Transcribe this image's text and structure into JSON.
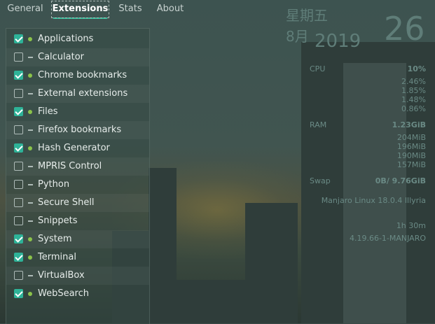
{
  "tabs": [
    {
      "label": "General",
      "active": false
    },
    {
      "label": "Extensions",
      "active": true
    },
    {
      "label": "Stats",
      "active": false
    },
    {
      "label": "About",
      "active": false
    }
  ],
  "extensions": [
    {
      "label": "Applications",
      "enabled": true
    },
    {
      "label": "Calculator",
      "enabled": false
    },
    {
      "label": "Chrome bookmarks",
      "enabled": true
    },
    {
      "label": "External extensions",
      "enabled": false
    },
    {
      "label": "Files",
      "enabled": true
    },
    {
      "label": "Firefox bookmarks",
      "enabled": false
    },
    {
      "label": "Hash Generator",
      "enabled": true
    },
    {
      "label": "MPRIS Control",
      "enabled": false
    },
    {
      "label": "Python",
      "enabled": false
    },
    {
      "label": "Secure Shell",
      "enabled": false
    },
    {
      "label": "Snippets",
      "enabled": false
    },
    {
      "label": "System",
      "enabled": true
    },
    {
      "label": "Terminal",
      "enabled": true
    },
    {
      "label": "VirtualBox",
      "enabled": false
    },
    {
      "label": "WebSearch",
      "enabled": true
    }
  ],
  "desktop_widget": {
    "day_of_week": "星期五",
    "month": "8月",
    "year": "2019",
    "date": "26",
    "cpu": {
      "label": "CPU",
      "value": "10%",
      "cores": [
        "2.46%",
        "1.85%",
        "1.48%",
        "0.86%"
      ]
    },
    "ram": {
      "label": "RAM",
      "value": "1.23GiB",
      "details": [
        "204MiB",
        "196MiB",
        "190MiB",
        "157MiB"
      ]
    },
    "swap": {
      "label": "Swap",
      "value": "0B/ 9.76GiB"
    },
    "os": "Manjaro Linux 18.0.4 Illyria",
    "uptime": "1h 30m",
    "kernel": "4.19.66-1-MANJARO"
  },
  "colors": {
    "accent": "#35bf9c",
    "checkbox_on": "#2eb398",
    "status_enabled_dot": "#8bc34a"
  }
}
